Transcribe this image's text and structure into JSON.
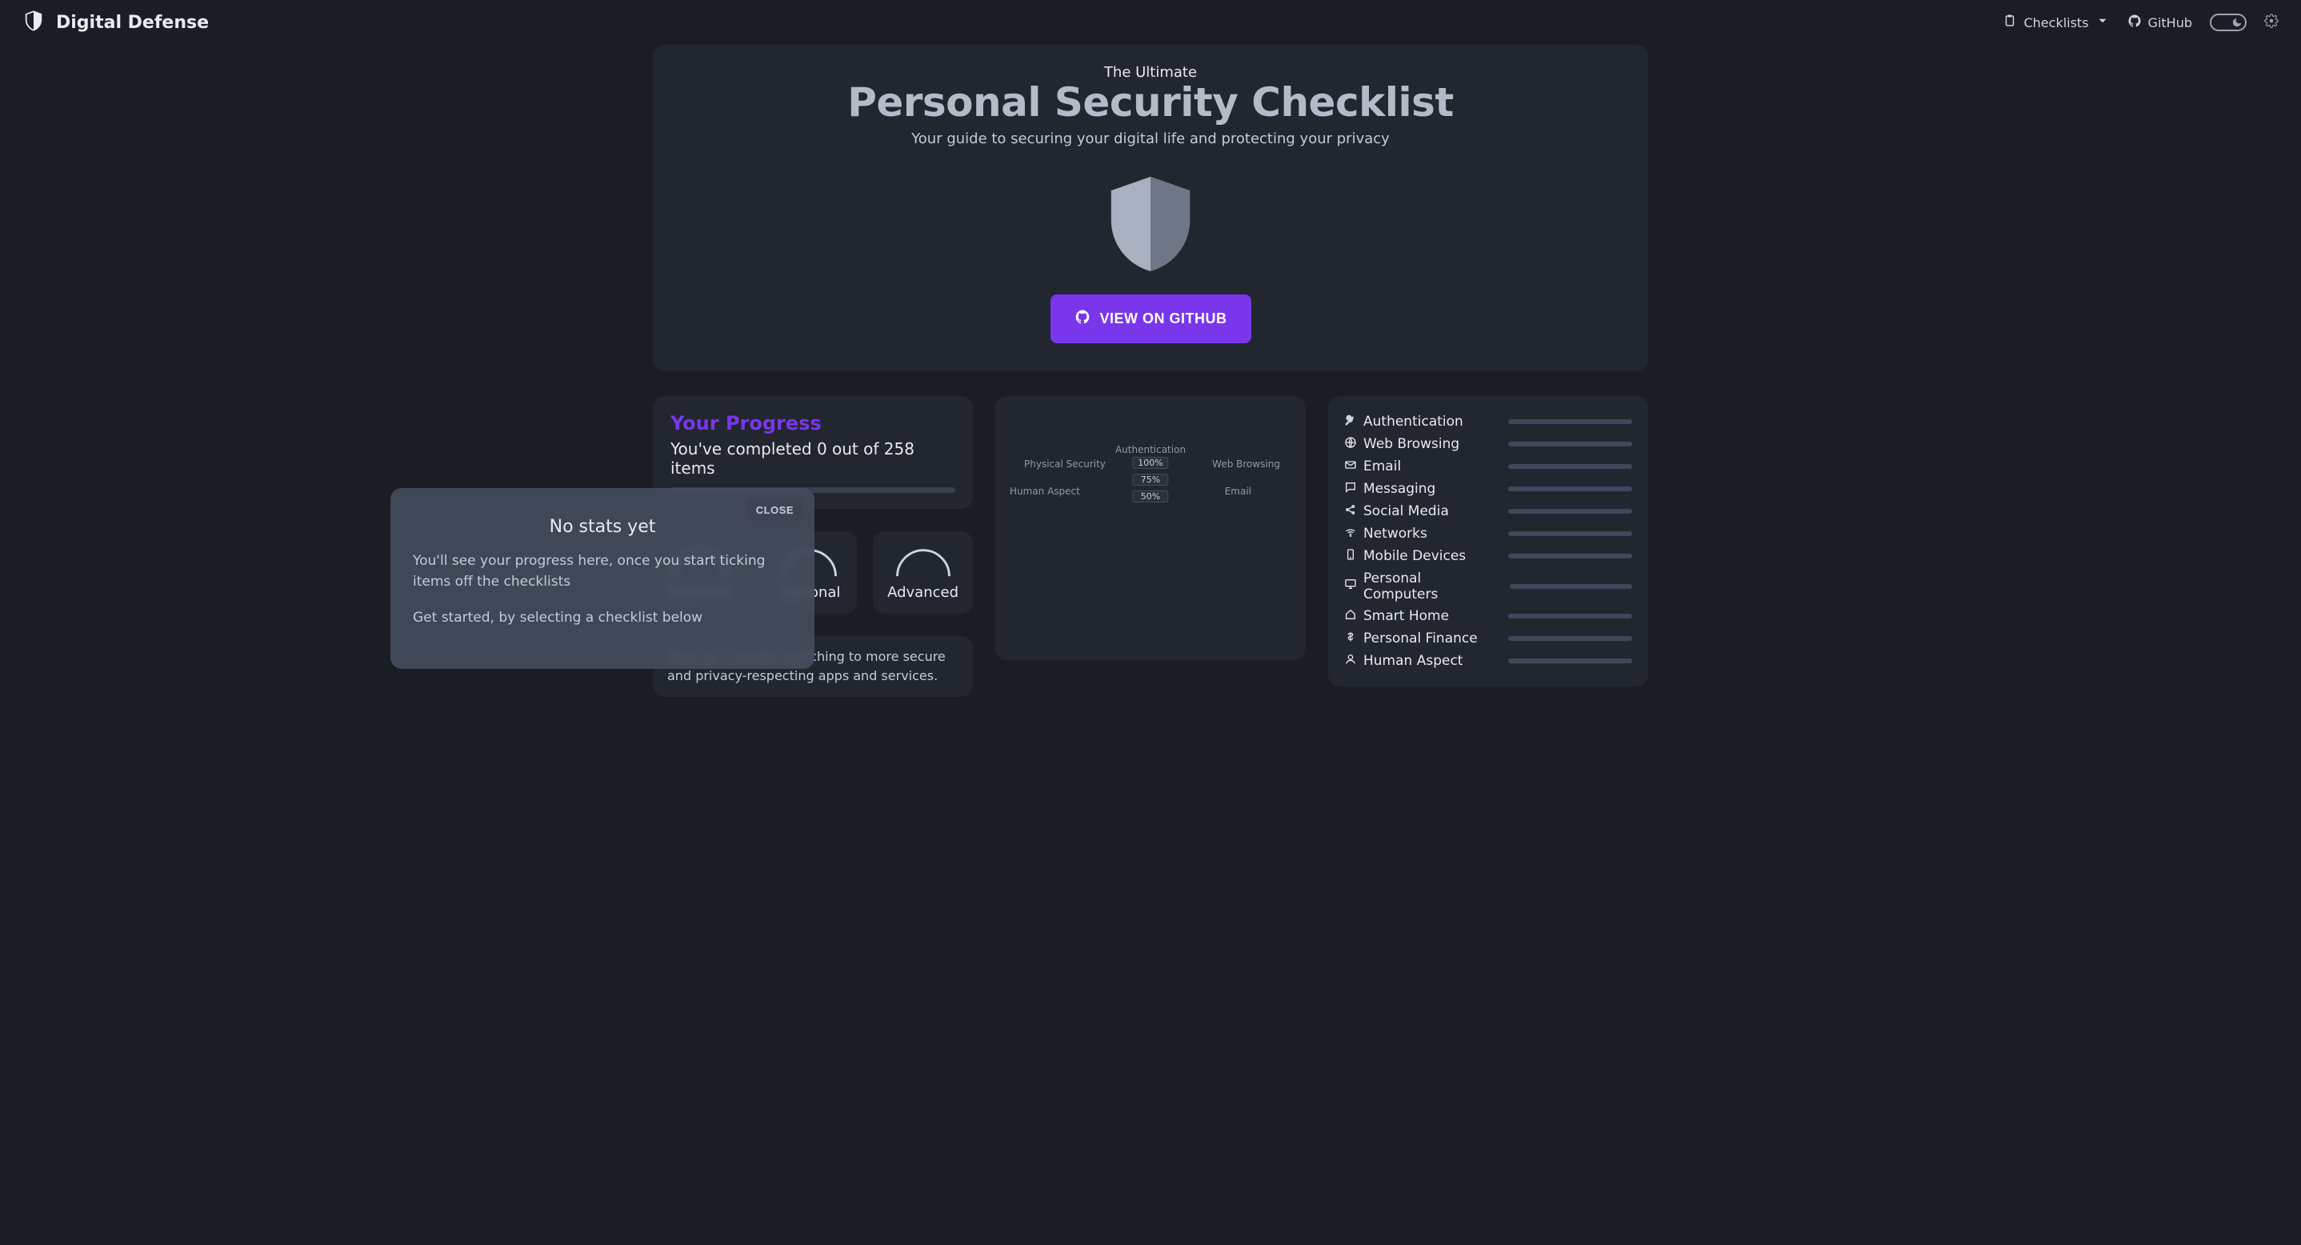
{
  "header": {
    "site_title": "Digital Defense",
    "nav_checklists": "Checklists",
    "nav_github": "GitHub"
  },
  "hero": {
    "eyebrow": "The Ultimate",
    "title": "Personal Security Checklist",
    "subtitle": "Your guide to securing your digital life and protecting your privacy",
    "button": "VIEW ON GITHUB"
  },
  "progress": {
    "title": "Your Progress",
    "text": "You've completed 0 out of 258 items"
  },
  "tiers": [
    {
      "name": "Essential"
    },
    {
      "name": "Optional"
    },
    {
      "name": "Advanced"
    }
  ],
  "tip": "Next up, consider switching to more secure and privacy-respecting apps and services.",
  "radar": {
    "labels": {
      "top": "Authentication",
      "right_upper": "Web Browsing",
      "right_lower": "Email",
      "left_upper": "Physical Security",
      "left_lower": "Human Aspect"
    },
    "rings": [
      "100%",
      "75%",
      "50%"
    ]
  },
  "categories": [
    {
      "icon": "key",
      "name": "Authentication"
    },
    {
      "icon": "globe",
      "name": "Web Browsing"
    },
    {
      "icon": "envelope",
      "name": "Email"
    },
    {
      "icon": "chat",
      "name": "Messaging"
    },
    {
      "icon": "share",
      "name": "Social Media"
    },
    {
      "icon": "wifi",
      "name": "Networks"
    },
    {
      "icon": "phone",
      "name": "Mobile Devices"
    },
    {
      "icon": "desktop",
      "name": "Personal Computers"
    },
    {
      "icon": "home",
      "name": "Smart Home"
    },
    {
      "icon": "dollar",
      "name": "Personal Finance"
    },
    {
      "icon": "user",
      "name": "Human Aspect"
    }
  ],
  "modal": {
    "close": "CLOSE",
    "title": "No stats yet",
    "line1": "You'll see your progress here, once you start ticking items off the checklists",
    "line2": "Get started, by selecting a checklist below"
  }
}
